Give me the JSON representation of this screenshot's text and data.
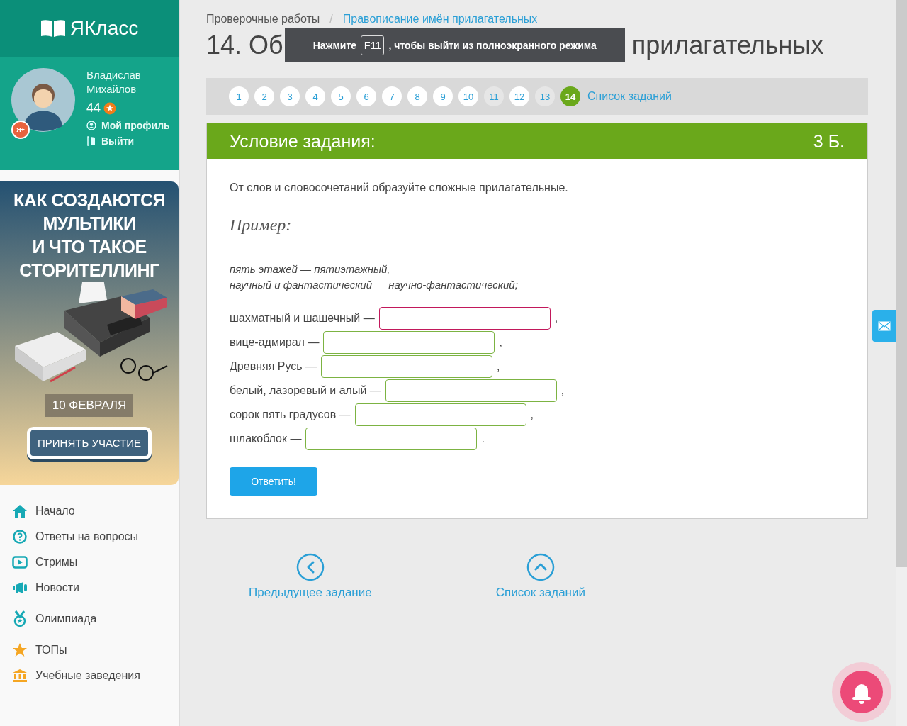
{
  "sidebar": {
    "logo": "ЯКласс",
    "user": {
      "first_name": "Владислав",
      "last_name": "Михайлов",
      "points": "44",
      "badge": "Я+",
      "links": [
        {
          "kind": "profile",
          "label": "Мой профиль"
        },
        {
          "kind": "logout",
          "label": "Выйти"
        }
      ]
    },
    "promo": {
      "headline": [
        "КАК СОЗДАЮТСЯ",
        "МУЛЬТИКИ",
        "И ЧТО ТАКОЕ",
        "СТОРИТЕЛЛИНГ"
      ],
      "date": "10 ФЕВРАЛЯ",
      "button": "ПРИНЯТЬ УЧАСТИЕ"
    },
    "nav_groups": [
      [
        {
          "kind": "home",
          "label": "Начало"
        },
        {
          "kind": "question",
          "label": "Ответы на вопросы"
        },
        {
          "kind": "play",
          "label": "Стримы"
        },
        {
          "kind": "news",
          "label": "Новости"
        }
      ],
      [
        {
          "kind": "medal",
          "label": "Олимпиада"
        }
      ],
      [
        {
          "kind": "star",
          "label": "ТОПы"
        },
        {
          "kind": "building",
          "label": "Учебные заведения"
        }
      ]
    ]
  },
  "breadcrumb_separator": "/",
  "breadcrumbs": [
    {
      "label": "Проверочные работы",
      "link": false
    },
    {
      "label": "Правописание имён прилагательных",
      "link": true
    }
  ],
  "title_visible": {
    "start": "14. Об",
    "end": "прилагательных"
  },
  "fullscreen_notice": {
    "before": "Нажмите",
    "key": "F11",
    "after": ", чтобы выйти из полноэкранного режима"
  },
  "pagination": {
    "pages": [
      {
        "label": "1",
        "selected": false,
        "dimmed": false
      },
      {
        "label": "2",
        "selected": false,
        "dimmed": false
      },
      {
        "label": "3",
        "selected": false,
        "dimmed": false
      },
      {
        "label": "4",
        "selected": false,
        "dimmed": false
      },
      {
        "label": "5",
        "selected": false,
        "dimmed": false
      },
      {
        "label": "6",
        "selected": false,
        "dimmed": false
      },
      {
        "label": "7",
        "selected": false,
        "dimmed": false
      },
      {
        "label": "8",
        "selected": false,
        "dimmed": false
      },
      {
        "label": "9",
        "selected": false,
        "dimmed": false
      },
      {
        "label": "10",
        "selected": false,
        "dimmed": false
      },
      {
        "label": "11",
        "selected": false,
        "dimmed": true
      },
      {
        "label": "12",
        "selected": false,
        "dimmed": false
      },
      {
        "label": "13",
        "selected": false,
        "dimmed": true
      },
      {
        "label": "14",
        "selected": true,
        "dimmed": false
      }
    ],
    "list_link": "Список заданий"
  },
  "task": {
    "header": "Условие задания:",
    "score": "3 Б.",
    "instruction": "От слов и словосочетаний образуйте сложные прилагательные.",
    "example_title": "Пример:",
    "example_lines": [
      "пять этажей — пятиэтажный,",
      "научный и фантастический — научно-фантастический;"
    ],
    "items": [
      {
        "prompt": "шахматный и шашечный —",
        "focused": true,
        "end": ","
      },
      {
        "prompt": "вице-адмирал —",
        "focused": false,
        "end": ","
      },
      {
        "prompt": "Древняя Русь —",
        "focused": false,
        "end": ","
      },
      {
        "prompt": "белый, лазоревый и алый —",
        "focused": false,
        "end": ","
      },
      {
        "prompt": "сорок пять градусов —",
        "focused": false,
        "end": ","
      },
      {
        "prompt": "шлакоблок —",
        "focused": false,
        "end": "."
      }
    ],
    "submit": "Ответить!"
  },
  "bottom_nav": [
    {
      "kind": "prev",
      "label": "Предыдущее задание"
    },
    {
      "kind": "list",
      "label": "Список заданий"
    }
  ]
}
